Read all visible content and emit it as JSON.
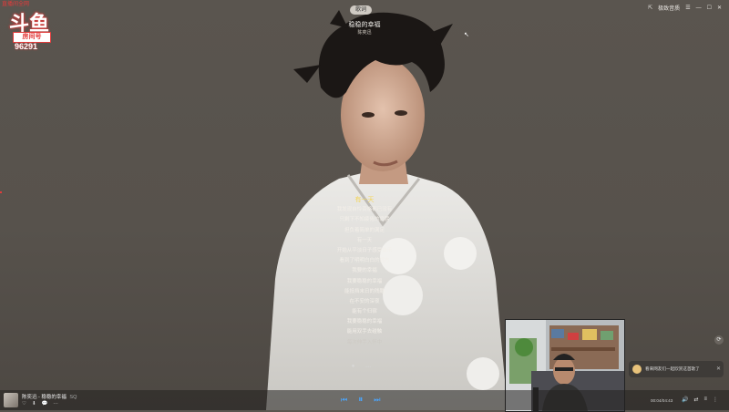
{
  "player": {
    "top_pill": "歌词",
    "song_title": "稳稳的幸福",
    "artist": "陈奕迅",
    "window_controls": [
      "⇱",
      "☰",
      "—",
      "☐",
      "✕"
    ],
    "upgrade_label": "极致音质"
  },
  "watermark": {
    "top_text": "直播间全网",
    "logo": "斗鱼",
    "room_label": "房间号",
    "room_number": "96291"
  },
  "lyrics": {
    "lines": [
      {
        "text": "有一天",
        "state": "active"
      },
      {
        "text": "我发现自怜资格都已没有",
        "state": "normal"
      },
      {
        "text": "只剩下不知疲倦的肩膀",
        "state": "normal"
      },
      {
        "text": "担负着简单的满足",
        "state": "normal"
      },
      {
        "text": "有一天",
        "state": "normal"
      },
      {
        "text": "开始从平淡日子感受快乐",
        "state": "normal"
      },
      {
        "text": "看到了明明白白的远方",
        "state": "normal"
      },
      {
        "text": "我要的幸福",
        "state": "normal"
      },
      {
        "text": "我要稳稳的幸福",
        "state": "normal"
      },
      {
        "text": "能抵挡末日的残酷",
        "state": "normal"
      },
      {
        "text": "在不安的深夜",
        "state": "normal"
      },
      {
        "text": "能有个归宿",
        "state": "normal"
      },
      {
        "text": "我要稳稳的幸福",
        "state": "normal"
      },
      {
        "text": "能用双手去碰触",
        "state": "normal"
      },
      {
        "text": "每次伸手入怀中",
        "state": "fade"
      }
    ],
    "pause_icon": "⏸",
    "more_icon": "⋯"
  },
  "side": {
    "button_icon": "⟳",
    "toast_text": "看来网友们一起欣赏这首歌了",
    "toast_close": "✕"
  },
  "bottom_bar": {
    "now_playing": "陈奕迅 - 稳稳的幸福",
    "quality": "SQ",
    "left_icons": [
      "♡",
      "⬇",
      "💬",
      "⋯"
    ],
    "prev": "⏮",
    "play": "⏸",
    "next": "⏭",
    "time": "00:04/04:43",
    "right_icons": [
      "🔊",
      "⇄",
      "≡",
      "⋮"
    ]
  },
  "colors": {
    "accent": "#4aa6ff",
    "active_lyric": "#f3d65c",
    "watermark_red": "#e23b3b"
  }
}
